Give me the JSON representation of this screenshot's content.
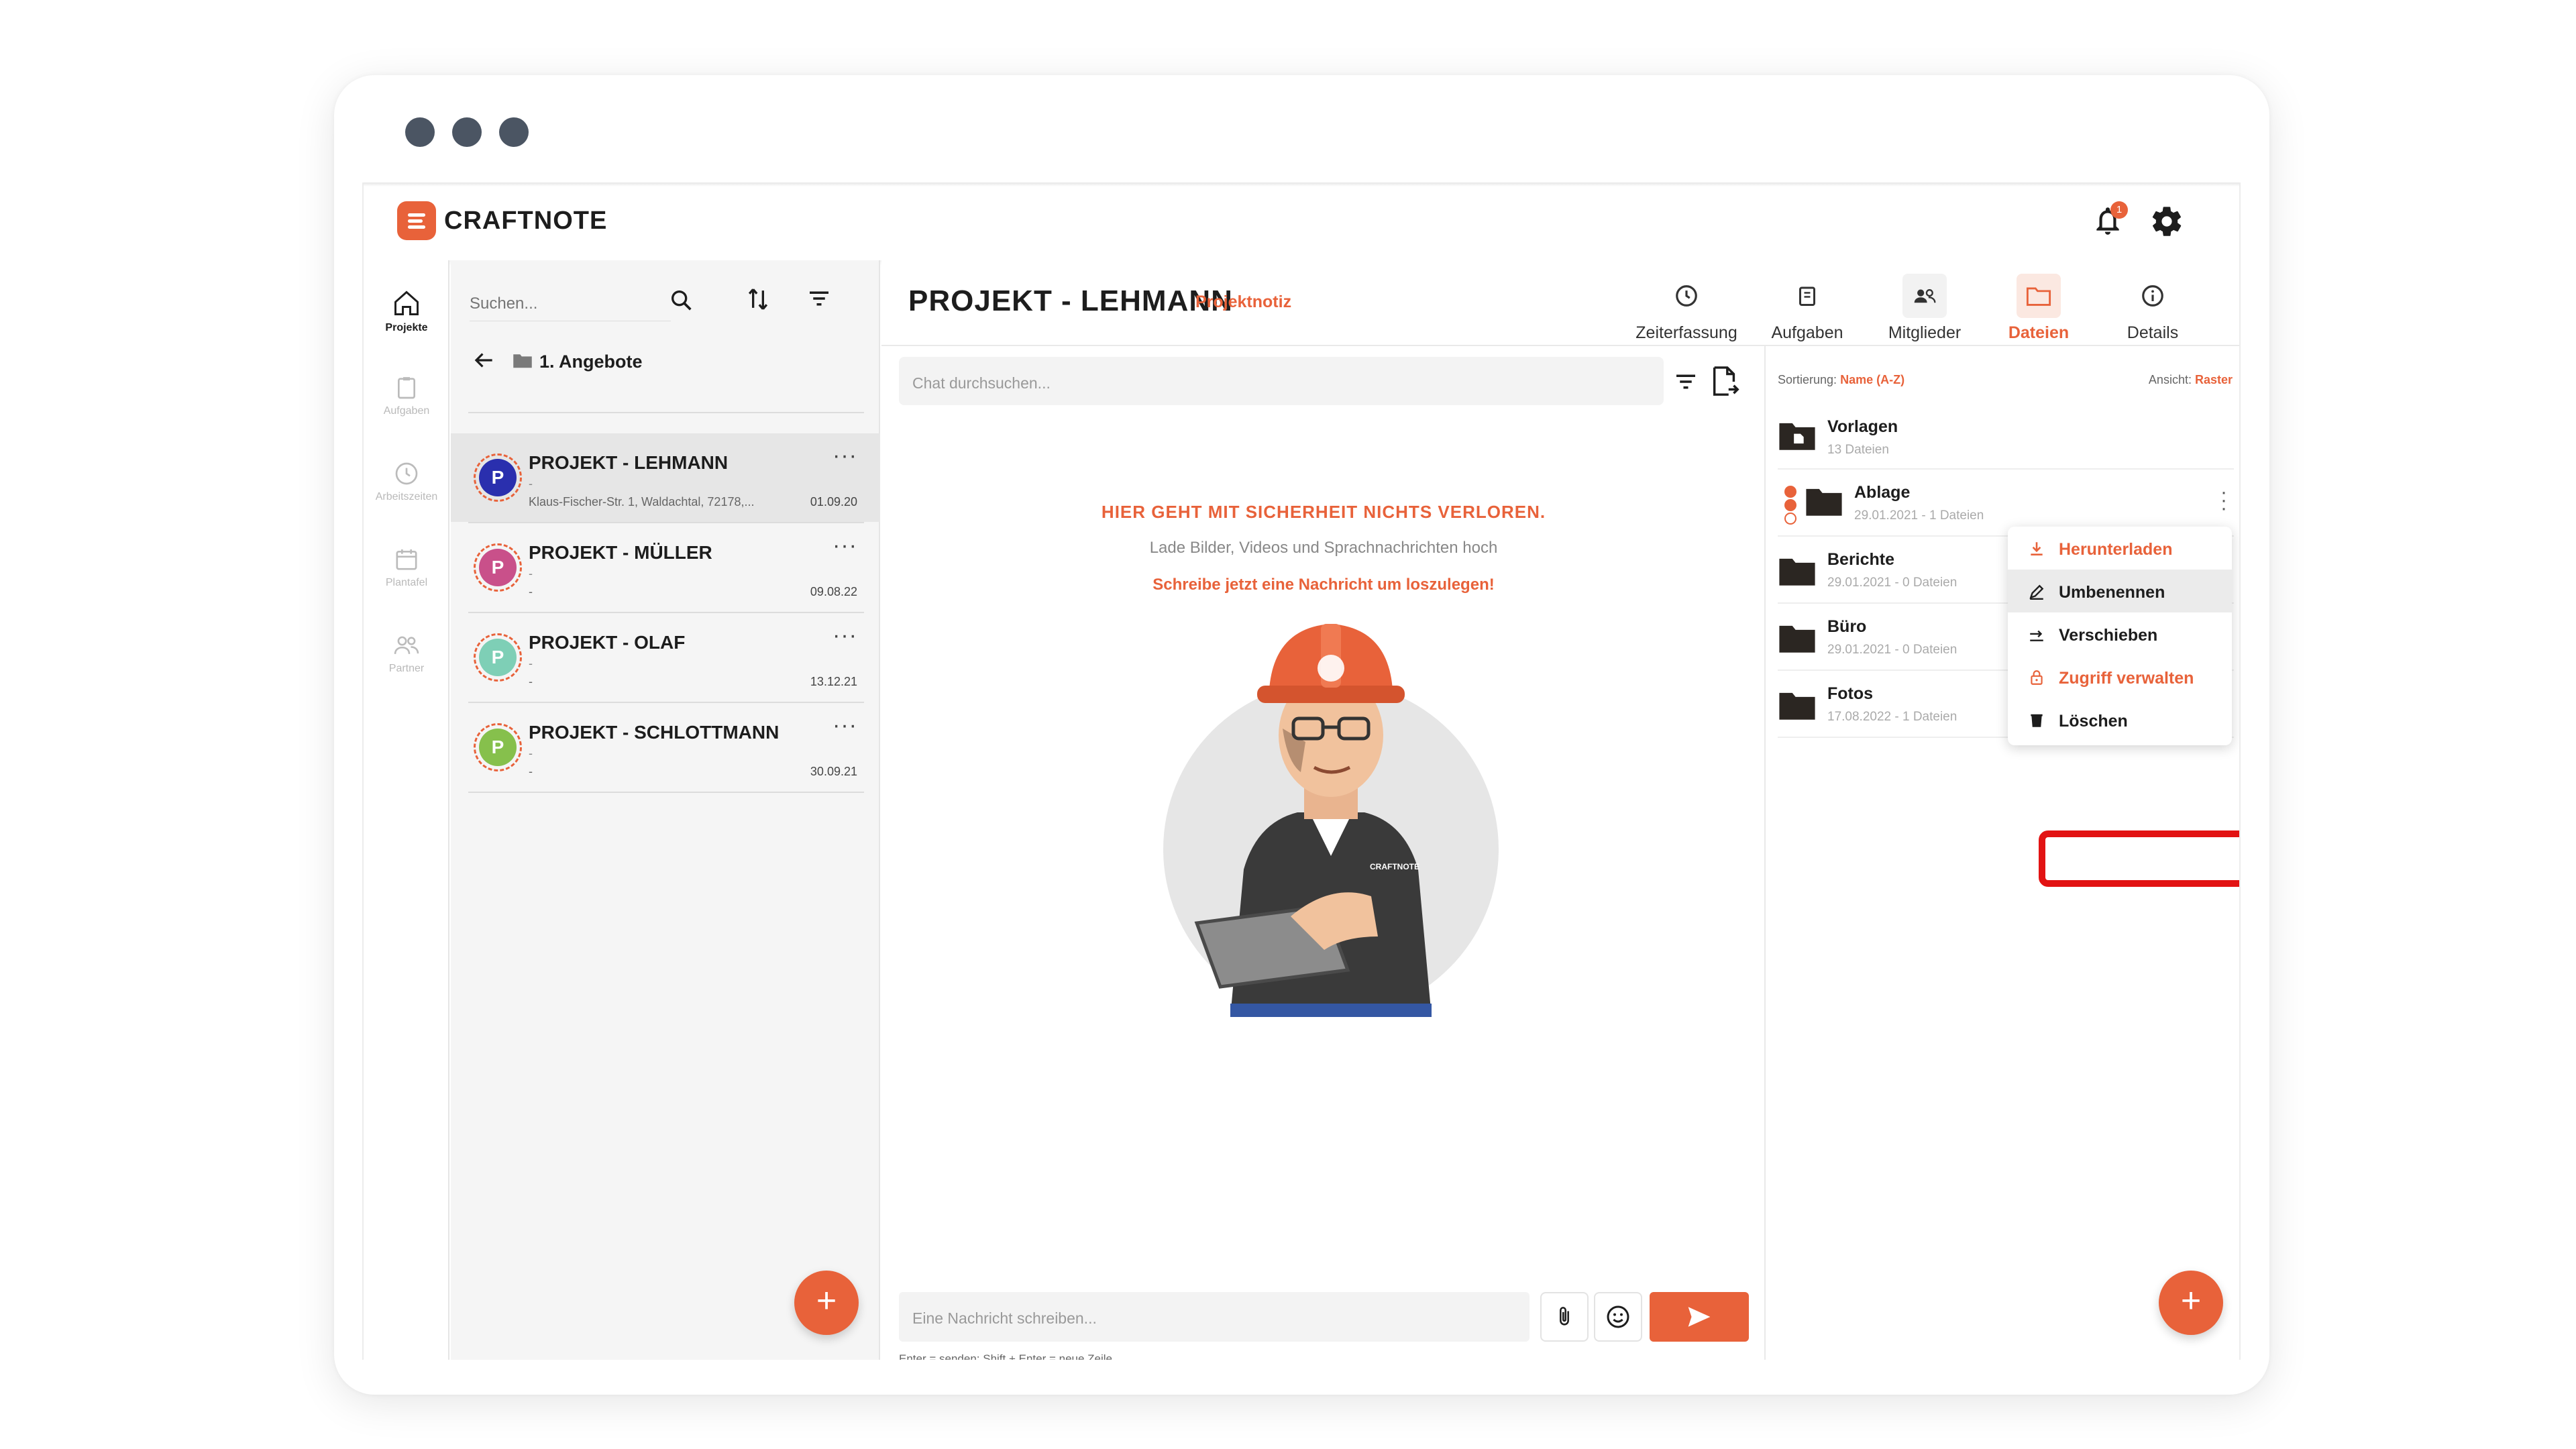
{
  "app": {
    "brand": "CRAFTNOTE",
    "notification_count": "1"
  },
  "nav": [
    {
      "label": "Projekte",
      "icon": "home-icon",
      "active": true
    },
    {
      "label": "Aufgaben",
      "icon": "clipboard-icon"
    },
    {
      "label": "Arbeitszeiten",
      "icon": "clock-icon"
    },
    {
      "label": "Plantafel",
      "icon": "calendar-icon"
    },
    {
      "label": "Partner",
      "icon": "people-icon"
    }
  ],
  "project_list": {
    "search_placeholder": "Suchen...",
    "breadcrumb": "1. Angebote",
    "items": [
      {
        "initial": "P",
        "title": "PROJEKT - LEHMANN",
        "desc": "-",
        "address": "Klaus-Fischer-Str. 1, Waldachtal, 72178,...",
        "date": "01.09.20",
        "color": "#2a2fae",
        "selected": true
      },
      {
        "initial": "P",
        "title": "PROJEKT - MÜLLER",
        "desc": "-",
        "address": "-",
        "date": "09.08.22",
        "color": "#c9508a"
      },
      {
        "initial": "P",
        "title": "PROJEKT - OLAF",
        "desc": "-",
        "address": "-",
        "date": "13.12.21",
        "color": "#7ecfb6"
      },
      {
        "initial": "P",
        "title": "PROJEKT - SCHLOTTMANN",
        "desc": "-",
        "address": "-",
        "date": "30.09.21",
        "color": "#86c04c"
      }
    ],
    "fab": "+"
  },
  "project": {
    "title": "PROJEKT - LEHMANN",
    "note": "Projektnotiz",
    "tabs": [
      {
        "label": "Zeiterfassung",
        "icon": "clock-icon"
      },
      {
        "label": "Aufgaben",
        "icon": "clipboard-icon"
      },
      {
        "label": "Mitglieder",
        "icon": "members-icon"
      },
      {
        "label": "Dateien",
        "icon": "folder-icon",
        "active": true
      },
      {
        "label": "Details",
        "icon": "info-icon"
      }
    ]
  },
  "chat": {
    "search_placeholder": "Chat durchsuchen...",
    "empty_title": "HIER GEHT MIT SICHERHEIT NICHTS VERLOREN.",
    "empty_sub": "Lade Bilder, Videos und Sprachnachrichten hoch",
    "empty_cta": "Schreibe jetzt eine Nachricht um loszulegen!",
    "message_placeholder": "Eine Nachricht schreiben...",
    "hint": "Enter = senden; Shift + Enter = neue Zeile",
    "shirt_logo": "CRAFTNOTE"
  },
  "files": {
    "sort_label": "Sortierung:",
    "sort_value": "Name (A-Z)",
    "view_label": "Ansicht:",
    "view_value": "Raster",
    "folders": [
      {
        "name": "Vorlagen",
        "meta": "13 Dateien"
      },
      {
        "name": "Ablage",
        "meta": "29.01.2021 - 1 Dateien"
      },
      {
        "name": "Berichte",
        "meta": "29.01.2021 - 0 Dateien"
      },
      {
        "name": "Büro",
        "meta": "29.01.2021 - 0 Dateien"
      },
      {
        "name": "Fotos",
        "meta": "17.08.2022 - 1 Dateien"
      }
    ],
    "context_menu": [
      {
        "label": "Herunterladen",
        "icon": "download-icon"
      },
      {
        "label": "Umbenennen",
        "icon": "pencil-icon"
      },
      {
        "label": "Verschieben",
        "icon": "move-icon"
      },
      {
        "label": "Zugriff verwalten",
        "icon": "lock-icon"
      },
      {
        "label": "Löschen",
        "icon": "trash-icon"
      }
    ],
    "fab": "+"
  },
  "colors": {
    "accent": "#e8623a",
    "highlight": "#e21313"
  }
}
